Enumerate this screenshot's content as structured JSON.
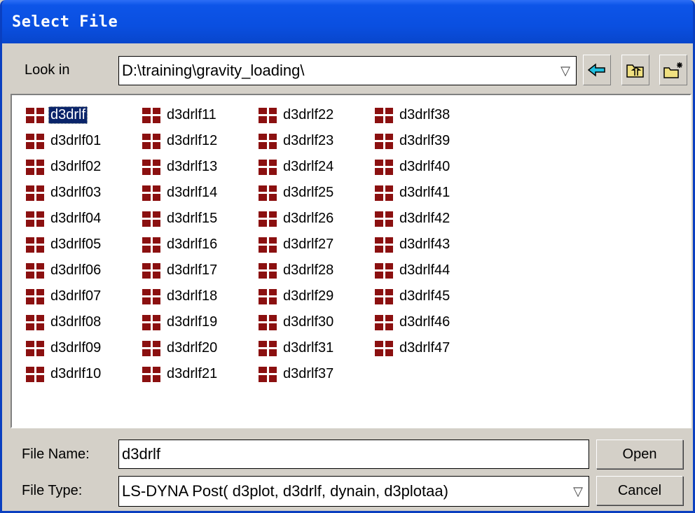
{
  "dialog": {
    "title": "Select File"
  },
  "look_in": {
    "label": "Look in",
    "path": "D:\\training\\gravity_loading\\",
    "arrow_icon": "▽"
  },
  "toolbar": {
    "back_icon": "arrow-left-icon",
    "up_icon": "up-folder-icon",
    "new_folder_icon": "new-folder-icon"
  },
  "files": {
    "selected": "d3drlf",
    "columns": [
      [
        "d3drlf",
        "d3drlf01",
        "d3drlf02",
        "d3drlf03",
        "d3drlf04",
        "d3drlf05",
        "d3drlf06",
        "d3drlf07",
        "d3drlf08",
        "d3drlf09",
        "d3drlf10"
      ],
      [
        "d3drlf11",
        "d3drlf12",
        "d3drlf13",
        "d3drlf14",
        "d3drlf15",
        "d3drlf16",
        "d3drlf17",
        "d3drlf18",
        "d3drlf19",
        "d3drlf20",
        "d3drlf21"
      ],
      [
        "d3drlf22",
        "d3drlf23",
        "d3drlf24",
        "d3drlf25",
        "d3drlf26",
        "d3drlf27",
        "d3drlf28",
        "d3drlf29",
        "d3drlf30",
        "d3drlf31",
        "d3drlf37"
      ],
      [
        "d3drlf38",
        "d3drlf39",
        "d3drlf40",
        "d3drlf41",
        "d3drlf42",
        "d3drlf43",
        "d3drlf44",
        "d3drlf45",
        "d3drlf46",
        "d3drlf47"
      ]
    ]
  },
  "file_name": {
    "label": "File Name:",
    "value": "d3drlf"
  },
  "file_type": {
    "label": "File Type:",
    "value": "LS-DYNA Post( d3plot, d3drlf, dynain, d3plotaa)",
    "arrow_icon": "▽"
  },
  "buttons": {
    "open": "Open",
    "cancel": "Cancel"
  },
  "colors": {
    "title_bar": "#0a4fe0",
    "file_icon": "#8b1010",
    "selection": "#0a246a"
  }
}
